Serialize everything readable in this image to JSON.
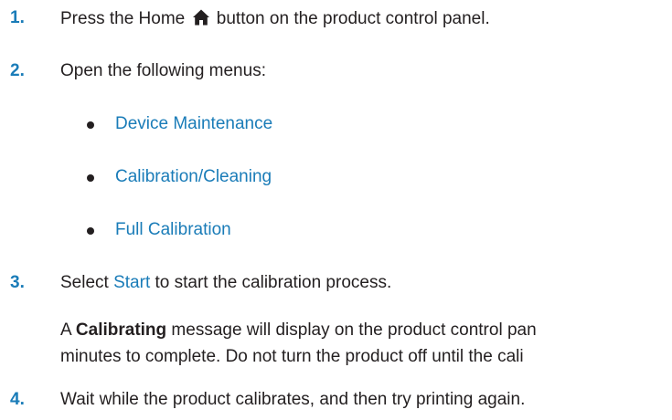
{
  "steps": [
    {
      "num": "1.",
      "before": "Press the Home",
      "icon": "home-icon",
      "after": "button on the product control panel."
    },
    {
      "num": "2.",
      "text": "Open the following menus:"
    },
    {
      "num": "3.",
      "before": "Select",
      "link": "Start",
      "after": "to start the calibration process."
    },
    {
      "num": "4.",
      "text": "Wait while the product calibrates, and then try printing again."
    }
  ],
  "menus": [
    "Device Maintenance",
    "Calibration/Cleaning",
    "Full Calibration"
  ],
  "note": {
    "prefix": "A",
    "bold": "Calibrating",
    "line1_rest": "message will display on the product control pan",
    "line2": "minutes to complete. Do not turn the product off until the cali"
  },
  "colors": {
    "accent": "#1a7cb8",
    "text": "#231f20"
  }
}
